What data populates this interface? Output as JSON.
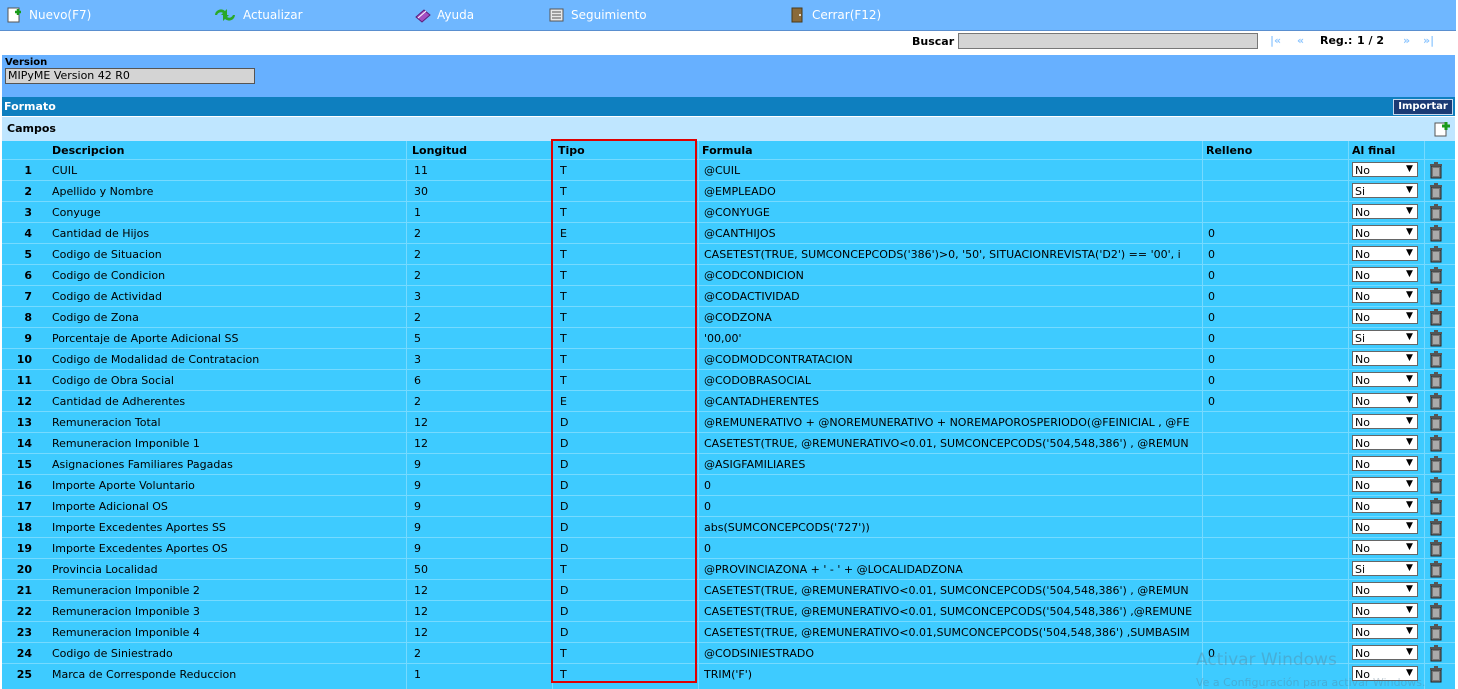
{
  "toolbar": {
    "nuevo": "Nuevo(F7)",
    "actualizar": "Actualizar",
    "ayuda": "Ayuda",
    "seguimiento": "Seguimiento",
    "cerrar": "Cerrar(F12)"
  },
  "search": {
    "label": "Buscar",
    "value": "",
    "first": "|«",
    "prev": "«",
    "reg_label": "Reg.:",
    "reg_value": "1 / 2",
    "next": "»",
    "last": "»|"
  },
  "version": {
    "label": "Version",
    "value": "MIPyME Version 42 R0"
  },
  "formato": {
    "label": "Formato",
    "import_label": "Importar"
  },
  "campos": {
    "label": "Campos"
  },
  "table": {
    "headers": {
      "descripcion": "Descripcion",
      "longitud": "Longitud",
      "tipo": "Tipo",
      "formula": "Formula",
      "relleno": "Relleno",
      "al_final": "Al final"
    },
    "rows": [
      {
        "n": "1",
        "desc": "CUIL",
        "len": "11",
        "tipo": "T",
        "formula": "@CUIL",
        "relleno": "",
        "final": "No"
      },
      {
        "n": "2",
        "desc": "Apellido y Nombre",
        "len": "30",
        "tipo": "T",
        "formula": "@EMPLEADO",
        "relleno": "",
        "final": "Si"
      },
      {
        "n": "3",
        "desc": "Conyuge",
        "len": "1",
        "tipo": "T",
        "formula": "@CONYUGE",
        "relleno": "",
        "final": "No"
      },
      {
        "n": "4",
        "desc": "Cantidad de Hijos",
        "len": "2",
        "tipo": "E",
        "formula": "@CANTHIJOS",
        "relleno": "0",
        "final": "No"
      },
      {
        "n": "5",
        "desc": "Codigo de Situacion",
        "len": "2",
        "tipo": "T",
        "formula": "CASETEST(TRUE,  SUMCONCEPCODS('386')>0, '50', SITUACIONREVISTA('D2') == '00', i",
        "relleno": "0",
        "final": "No"
      },
      {
        "n": "6",
        "desc": "Codigo de Condicion",
        "len": "2",
        "tipo": "T",
        "formula": "@CODCONDICION",
        "relleno": "0",
        "final": "No"
      },
      {
        "n": "7",
        "desc": "Codigo de Actividad",
        "len": "3",
        "tipo": "T",
        "formula": "@CODACTIVIDAD",
        "relleno": "0",
        "final": "No"
      },
      {
        "n": "8",
        "desc": "Codigo de Zona",
        "len": "2",
        "tipo": "T",
        "formula": "@CODZONA",
        "relleno": "0",
        "final": "No"
      },
      {
        "n": "9",
        "desc": "Porcentaje de Aporte Adicional SS",
        "len": "5",
        "tipo": "T",
        "formula": "'00,00'",
        "relleno": "0",
        "final": "Si"
      },
      {
        "n": "10",
        "desc": "Codigo de Modalidad de Contratacion",
        "len": "3",
        "tipo": "T",
        "formula": "@CODMODCONTRATACION",
        "relleno": "0",
        "final": "No"
      },
      {
        "n": "11",
        "desc": "Codigo de Obra Social",
        "len": "6",
        "tipo": "T",
        "formula": "@CODOBRASOCIAL",
        "relleno": "0",
        "final": "No"
      },
      {
        "n": "12",
        "desc": "Cantidad de Adherentes",
        "len": "2",
        "tipo": "E",
        "formula": "@CANTADHERENTES",
        "relleno": "0",
        "final": "No"
      },
      {
        "n": "13",
        "desc": "Remuneracion Total",
        "len": "12",
        "tipo": "D",
        "formula": "@REMUNERATIVO + @NOREMUNERATIVO + NOREMAPOROSPERIODO(@FEINICIAL , @FE",
        "relleno": "",
        "final": "No"
      },
      {
        "n": "14",
        "desc": "Remuneracion Imponible 1",
        "len": "12",
        "tipo": "D",
        "formula": "CASETEST(TRUE, @REMUNERATIVO<0.01, SUMCONCEPCODS('504,548,386') , @REMUN",
        "relleno": "",
        "final": "No"
      },
      {
        "n": "15",
        "desc": "Asignaciones Familiares Pagadas",
        "len": "9",
        "tipo": "D",
        "formula": "@ASIGFAMILIARES",
        "relleno": "",
        "final": "No"
      },
      {
        "n": "16",
        "desc": "Importe Aporte Voluntario",
        "len": "9",
        "tipo": "D",
        "formula": "0",
        "relleno": "",
        "final": "No"
      },
      {
        "n": "17",
        "desc": "Importe Adicional OS",
        "len": "9",
        "tipo": "D",
        "formula": "0",
        "relleno": "",
        "final": "No"
      },
      {
        "n": "18",
        "desc": "Importe Excedentes Aportes SS",
        "len": "9",
        "tipo": "D",
        "formula": "abs(SUMCONCEPCODS('727'))",
        "relleno": "",
        "final": "No"
      },
      {
        "n": "19",
        "desc": "Importe Excedentes Aportes OS",
        "len": "9",
        "tipo": "D",
        "formula": "0",
        "relleno": "",
        "final": "No"
      },
      {
        "n": "20",
        "desc": "Provincia Localidad",
        "len": "50",
        "tipo": "T",
        "formula": "@PROVINCIAZONA + ' - ' + @LOCALIDADZONA",
        "relleno": "",
        "final": "Si"
      },
      {
        "n": "21",
        "desc": "Remuneracion Imponible 2",
        "len": "12",
        "tipo": "D",
        "formula": " CASETEST(TRUE, @REMUNERATIVO<0.01, SUMCONCEPCODS('504,548,386') , @REMUN",
        "relleno": "",
        "final": "No"
      },
      {
        "n": "22",
        "desc": "Remuneracion Imponible 3",
        "len": "12",
        "tipo": "D",
        "formula": "CASETEST(TRUE, @REMUNERATIVO<0.01, SUMCONCEPCODS('504,548,386') ,@REMUNE",
        "relleno": "",
        "final": "No"
      },
      {
        "n": "23",
        "desc": "Remuneracion Imponible 4",
        "len": "12",
        "tipo": "D",
        "formula": "CASETEST(TRUE, @REMUNERATIVO<0.01,SUMCONCEPCODS('504,548,386') ,SUMBASIM",
        "relleno": "",
        "final": "No"
      },
      {
        "n": "24",
        "desc": "Codigo de Siniestrado",
        "len": "2",
        "tipo": "T",
        "formula": "@CODSINIESTRADO",
        "relleno": "0",
        "final": "No"
      },
      {
        "n": "25",
        "desc": "Marca de Corresponde Reduccion",
        "len": "1",
        "tipo": "T",
        "formula": "TRIM('F')",
        "relleno": "",
        "final": "No"
      }
    ]
  },
  "watermark": {
    "line1": "Activar Windows",
    "line2": "Ve a Configuración para activar Windows."
  }
}
